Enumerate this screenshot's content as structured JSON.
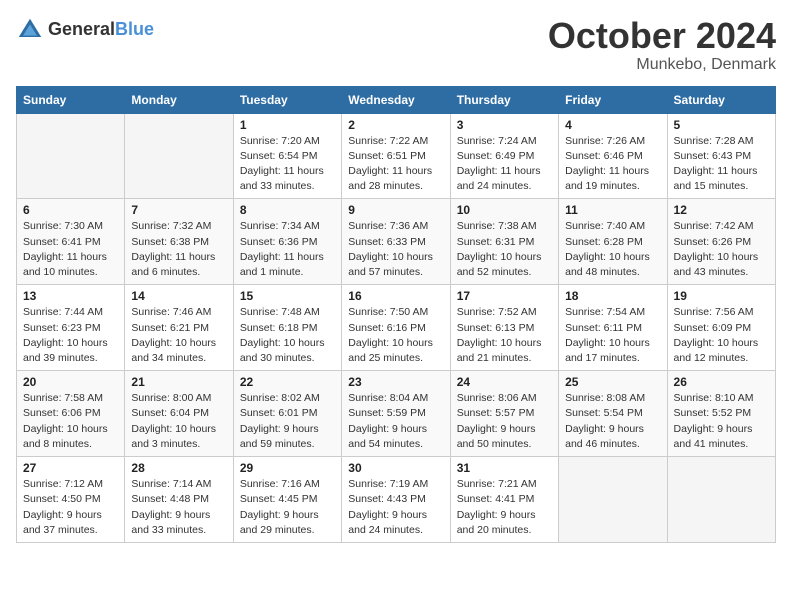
{
  "header": {
    "logo_general": "General",
    "logo_blue": "Blue",
    "title": "October 2024",
    "location": "Munkebo, Denmark"
  },
  "columns": [
    "Sunday",
    "Monday",
    "Tuesday",
    "Wednesday",
    "Thursday",
    "Friday",
    "Saturday"
  ],
  "weeks": [
    [
      {
        "day": "",
        "info": ""
      },
      {
        "day": "",
        "info": ""
      },
      {
        "day": "1",
        "info": "Sunrise: 7:20 AM\nSunset: 6:54 PM\nDaylight: 11 hours\nand 33 minutes."
      },
      {
        "day": "2",
        "info": "Sunrise: 7:22 AM\nSunset: 6:51 PM\nDaylight: 11 hours\nand 28 minutes."
      },
      {
        "day": "3",
        "info": "Sunrise: 7:24 AM\nSunset: 6:49 PM\nDaylight: 11 hours\nand 24 minutes."
      },
      {
        "day": "4",
        "info": "Sunrise: 7:26 AM\nSunset: 6:46 PM\nDaylight: 11 hours\nand 19 minutes."
      },
      {
        "day": "5",
        "info": "Sunrise: 7:28 AM\nSunset: 6:43 PM\nDaylight: 11 hours\nand 15 minutes."
      }
    ],
    [
      {
        "day": "6",
        "info": "Sunrise: 7:30 AM\nSunset: 6:41 PM\nDaylight: 11 hours\nand 10 minutes."
      },
      {
        "day": "7",
        "info": "Sunrise: 7:32 AM\nSunset: 6:38 PM\nDaylight: 11 hours\nand 6 minutes."
      },
      {
        "day": "8",
        "info": "Sunrise: 7:34 AM\nSunset: 6:36 PM\nDaylight: 11 hours\nand 1 minute."
      },
      {
        "day": "9",
        "info": "Sunrise: 7:36 AM\nSunset: 6:33 PM\nDaylight: 10 hours\nand 57 minutes."
      },
      {
        "day": "10",
        "info": "Sunrise: 7:38 AM\nSunset: 6:31 PM\nDaylight: 10 hours\nand 52 minutes."
      },
      {
        "day": "11",
        "info": "Sunrise: 7:40 AM\nSunset: 6:28 PM\nDaylight: 10 hours\nand 48 minutes."
      },
      {
        "day": "12",
        "info": "Sunrise: 7:42 AM\nSunset: 6:26 PM\nDaylight: 10 hours\nand 43 minutes."
      }
    ],
    [
      {
        "day": "13",
        "info": "Sunrise: 7:44 AM\nSunset: 6:23 PM\nDaylight: 10 hours\nand 39 minutes."
      },
      {
        "day": "14",
        "info": "Sunrise: 7:46 AM\nSunset: 6:21 PM\nDaylight: 10 hours\nand 34 minutes."
      },
      {
        "day": "15",
        "info": "Sunrise: 7:48 AM\nSunset: 6:18 PM\nDaylight: 10 hours\nand 30 minutes."
      },
      {
        "day": "16",
        "info": "Sunrise: 7:50 AM\nSunset: 6:16 PM\nDaylight: 10 hours\nand 25 minutes."
      },
      {
        "day": "17",
        "info": "Sunrise: 7:52 AM\nSunset: 6:13 PM\nDaylight: 10 hours\nand 21 minutes."
      },
      {
        "day": "18",
        "info": "Sunrise: 7:54 AM\nSunset: 6:11 PM\nDaylight: 10 hours\nand 17 minutes."
      },
      {
        "day": "19",
        "info": "Sunrise: 7:56 AM\nSunset: 6:09 PM\nDaylight: 10 hours\nand 12 minutes."
      }
    ],
    [
      {
        "day": "20",
        "info": "Sunrise: 7:58 AM\nSunset: 6:06 PM\nDaylight: 10 hours\nand 8 minutes."
      },
      {
        "day": "21",
        "info": "Sunrise: 8:00 AM\nSunset: 6:04 PM\nDaylight: 10 hours\nand 3 minutes."
      },
      {
        "day": "22",
        "info": "Sunrise: 8:02 AM\nSunset: 6:01 PM\nDaylight: 9 hours\nand 59 minutes."
      },
      {
        "day": "23",
        "info": "Sunrise: 8:04 AM\nSunset: 5:59 PM\nDaylight: 9 hours\nand 54 minutes."
      },
      {
        "day": "24",
        "info": "Sunrise: 8:06 AM\nSunset: 5:57 PM\nDaylight: 9 hours\nand 50 minutes."
      },
      {
        "day": "25",
        "info": "Sunrise: 8:08 AM\nSunset: 5:54 PM\nDaylight: 9 hours\nand 46 minutes."
      },
      {
        "day": "26",
        "info": "Sunrise: 8:10 AM\nSunset: 5:52 PM\nDaylight: 9 hours\nand 41 minutes."
      }
    ],
    [
      {
        "day": "27",
        "info": "Sunrise: 7:12 AM\nSunset: 4:50 PM\nDaylight: 9 hours\nand 37 minutes."
      },
      {
        "day": "28",
        "info": "Sunrise: 7:14 AM\nSunset: 4:48 PM\nDaylight: 9 hours\nand 33 minutes."
      },
      {
        "day": "29",
        "info": "Sunrise: 7:16 AM\nSunset: 4:45 PM\nDaylight: 9 hours\nand 29 minutes."
      },
      {
        "day": "30",
        "info": "Sunrise: 7:19 AM\nSunset: 4:43 PM\nDaylight: 9 hours\nand 24 minutes."
      },
      {
        "day": "31",
        "info": "Sunrise: 7:21 AM\nSunset: 4:41 PM\nDaylight: 9 hours\nand 20 minutes."
      },
      {
        "day": "",
        "info": ""
      },
      {
        "day": "",
        "info": ""
      }
    ]
  ]
}
